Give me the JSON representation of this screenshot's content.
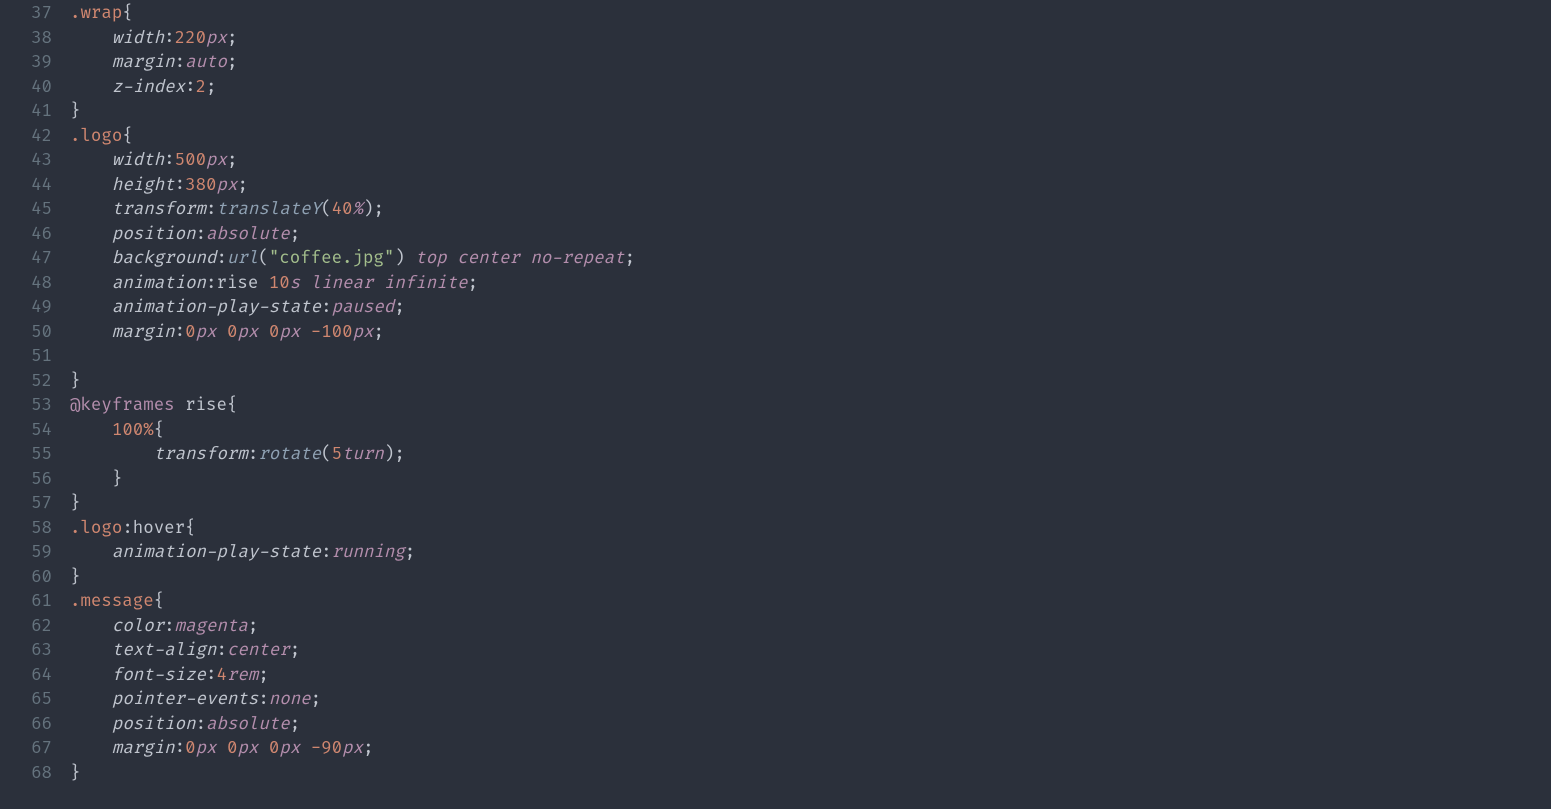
{
  "startLine": 37,
  "lines": [
    [
      {
        "t": "sel",
        "v": ".wrap"
      },
      {
        "t": "brace",
        "v": "{"
      }
    ],
    [
      {
        "t": "indent",
        "v": "    "
      },
      {
        "t": "prop",
        "v": "width"
      },
      {
        "t": "punct",
        "v": ":"
      },
      {
        "t": "num",
        "v": "220"
      },
      {
        "t": "unit",
        "v": "px"
      },
      {
        "t": "punct",
        "v": ";"
      }
    ],
    [
      {
        "t": "indent",
        "v": "    "
      },
      {
        "t": "prop",
        "v": "margin"
      },
      {
        "t": "punct",
        "v": ":"
      },
      {
        "t": "kw",
        "v": "auto"
      },
      {
        "t": "punct",
        "v": ";"
      }
    ],
    [
      {
        "t": "indent",
        "v": "    "
      },
      {
        "t": "prop",
        "v": "z-index"
      },
      {
        "t": "punct",
        "v": ":"
      },
      {
        "t": "num",
        "v": "2"
      },
      {
        "t": "punct",
        "v": ";"
      }
    ],
    [
      {
        "t": "brace",
        "v": "}"
      }
    ],
    [
      {
        "t": "sel",
        "v": ".logo"
      },
      {
        "t": "brace",
        "v": "{"
      }
    ],
    [
      {
        "t": "indent",
        "v": "    "
      },
      {
        "t": "prop",
        "v": "width"
      },
      {
        "t": "punct",
        "v": ":"
      },
      {
        "t": "num",
        "v": "500"
      },
      {
        "t": "unit",
        "v": "px"
      },
      {
        "t": "punct",
        "v": ";"
      }
    ],
    [
      {
        "t": "indent",
        "v": "    "
      },
      {
        "t": "prop",
        "v": "height"
      },
      {
        "t": "punct",
        "v": ":"
      },
      {
        "t": "num",
        "v": "380"
      },
      {
        "t": "unit",
        "v": "px"
      },
      {
        "t": "punct",
        "v": ";"
      }
    ],
    [
      {
        "t": "indent",
        "v": "    "
      },
      {
        "t": "prop",
        "v": "transform"
      },
      {
        "t": "punct",
        "v": ":"
      },
      {
        "t": "func",
        "v": "translateY"
      },
      {
        "t": "punct",
        "v": "("
      },
      {
        "t": "num",
        "v": "40"
      },
      {
        "t": "unit",
        "v": "%"
      },
      {
        "t": "punct",
        "v": ")"
      },
      {
        "t": "punct",
        "v": ";"
      }
    ],
    [
      {
        "t": "indent",
        "v": "    "
      },
      {
        "t": "prop",
        "v": "position"
      },
      {
        "t": "punct",
        "v": ":"
      },
      {
        "t": "kw",
        "v": "absolute"
      },
      {
        "t": "punct",
        "v": ";"
      }
    ],
    [
      {
        "t": "indent",
        "v": "    "
      },
      {
        "t": "prop",
        "v": "background"
      },
      {
        "t": "punct",
        "v": ":"
      },
      {
        "t": "func",
        "v": "url"
      },
      {
        "t": "punct",
        "v": "("
      },
      {
        "t": "str",
        "v": "\"coffee.jpg\""
      },
      {
        "t": "punct",
        "v": ")"
      },
      {
        "t": "indent",
        "v": " "
      },
      {
        "t": "kw",
        "v": "top"
      },
      {
        "t": "indent",
        "v": " "
      },
      {
        "t": "kw",
        "v": "center"
      },
      {
        "t": "indent",
        "v": " "
      },
      {
        "t": "kw",
        "v": "no-repeat"
      },
      {
        "t": "punct",
        "v": ";"
      }
    ],
    [
      {
        "t": "indent",
        "v": "    "
      },
      {
        "t": "prop",
        "v": "animation"
      },
      {
        "t": "punct",
        "v": ":"
      },
      {
        "t": "ident",
        "v": "rise "
      },
      {
        "t": "num",
        "v": "10"
      },
      {
        "t": "unit",
        "v": "s"
      },
      {
        "t": "indent",
        "v": " "
      },
      {
        "t": "kw",
        "v": "linear"
      },
      {
        "t": "indent",
        "v": " "
      },
      {
        "t": "kw",
        "v": "infinite"
      },
      {
        "t": "punct",
        "v": ";"
      }
    ],
    [
      {
        "t": "indent",
        "v": "    "
      },
      {
        "t": "prop",
        "v": "animation-play-state"
      },
      {
        "t": "punct",
        "v": ":"
      },
      {
        "t": "kw",
        "v": "paused"
      },
      {
        "t": "punct",
        "v": ";"
      }
    ],
    [
      {
        "t": "indent",
        "v": "    "
      },
      {
        "t": "prop",
        "v": "margin"
      },
      {
        "t": "punct",
        "v": ":"
      },
      {
        "t": "num",
        "v": "0"
      },
      {
        "t": "unit",
        "v": "px"
      },
      {
        "t": "indent",
        "v": " "
      },
      {
        "t": "num",
        "v": "0"
      },
      {
        "t": "unit",
        "v": "px"
      },
      {
        "t": "indent",
        "v": " "
      },
      {
        "t": "num",
        "v": "0"
      },
      {
        "t": "unit",
        "v": "px"
      },
      {
        "t": "indent",
        "v": " "
      },
      {
        "t": "num",
        "v": "-100"
      },
      {
        "t": "unit",
        "v": "px"
      },
      {
        "t": "punct",
        "v": ";"
      }
    ],
    [],
    [
      {
        "t": "brace",
        "v": "}"
      }
    ],
    [
      {
        "t": "at",
        "v": "@keyframes"
      },
      {
        "t": "atname",
        "v": " rise"
      },
      {
        "t": "brace",
        "v": "{"
      }
    ],
    [
      {
        "t": "indent",
        "v": "    "
      },
      {
        "t": "pct",
        "v": "100%"
      },
      {
        "t": "brace",
        "v": "{"
      }
    ],
    [
      {
        "t": "indent",
        "v": "        "
      },
      {
        "t": "prop",
        "v": "transform"
      },
      {
        "t": "punct",
        "v": ":"
      },
      {
        "t": "func",
        "v": "rotate"
      },
      {
        "t": "punct",
        "v": "("
      },
      {
        "t": "num",
        "v": "5"
      },
      {
        "t": "unit",
        "v": "turn"
      },
      {
        "t": "punct",
        "v": ")"
      },
      {
        "t": "punct",
        "v": ";"
      }
    ],
    [
      {
        "t": "indent",
        "v": "    "
      },
      {
        "t": "brace",
        "v": "}"
      }
    ],
    [
      {
        "t": "brace",
        "v": "}"
      }
    ],
    [
      {
        "t": "sel",
        "v": ".logo"
      },
      {
        "t": "pseudo",
        "v": ":hover"
      },
      {
        "t": "brace",
        "v": "{"
      }
    ],
    [
      {
        "t": "indent",
        "v": "    "
      },
      {
        "t": "prop",
        "v": "animation-play-state"
      },
      {
        "t": "punct",
        "v": ":"
      },
      {
        "t": "kw",
        "v": "running"
      },
      {
        "t": "punct",
        "v": ";"
      }
    ],
    [
      {
        "t": "brace",
        "v": "}"
      }
    ],
    [
      {
        "t": "sel",
        "v": ".message"
      },
      {
        "t": "brace",
        "v": "{"
      }
    ],
    [
      {
        "t": "indent",
        "v": "    "
      },
      {
        "t": "prop",
        "v": "color"
      },
      {
        "t": "punct",
        "v": ":"
      },
      {
        "t": "kw",
        "v": "magenta"
      },
      {
        "t": "punct",
        "v": ";"
      }
    ],
    [
      {
        "t": "indent",
        "v": "    "
      },
      {
        "t": "prop",
        "v": "text-align"
      },
      {
        "t": "punct",
        "v": ":"
      },
      {
        "t": "kw",
        "v": "center"
      },
      {
        "t": "punct",
        "v": ";"
      }
    ],
    [
      {
        "t": "indent",
        "v": "    "
      },
      {
        "t": "prop",
        "v": "font-size"
      },
      {
        "t": "punct",
        "v": ":"
      },
      {
        "t": "num",
        "v": "4"
      },
      {
        "t": "unit",
        "v": "rem"
      },
      {
        "t": "punct",
        "v": ";"
      }
    ],
    [
      {
        "t": "indent",
        "v": "    "
      },
      {
        "t": "prop",
        "v": "pointer-events"
      },
      {
        "t": "punct",
        "v": ":"
      },
      {
        "t": "kw",
        "v": "none"
      },
      {
        "t": "punct",
        "v": ";"
      }
    ],
    [
      {
        "t": "indent",
        "v": "    "
      },
      {
        "t": "prop",
        "v": "position"
      },
      {
        "t": "punct",
        "v": ":"
      },
      {
        "t": "kw",
        "v": "absolute"
      },
      {
        "t": "punct",
        "v": ";"
      }
    ],
    [
      {
        "t": "indent",
        "v": "    "
      },
      {
        "t": "prop",
        "v": "margin"
      },
      {
        "t": "punct",
        "v": ":"
      },
      {
        "t": "num",
        "v": "0"
      },
      {
        "t": "unit",
        "v": "px"
      },
      {
        "t": "indent",
        "v": " "
      },
      {
        "t": "num",
        "v": "0"
      },
      {
        "t": "unit",
        "v": "px"
      },
      {
        "t": "indent",
        "v": " "
      },
      {
        "t": "num",
        "v": "0"
      },
      {
        "t": "unit",
        "v": "px"
      },
      {
        "t": "indent",
        "v": " "
      },
      {
        "t": "num",
        "v": "-90"
      },
      {
        "t": "unit",
        "v": "px"
      },
      {
        "t": "punct",
        "v": ";"
      }
    ],
    [
      {
        "t": "brace",
        "v": "}"
      }
    ]
  ]
}
